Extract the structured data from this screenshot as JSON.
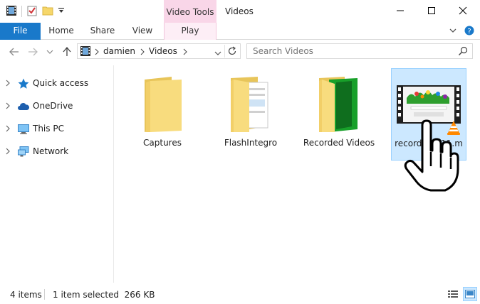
{
  "window": {
    "title": "Videos",
    "context_tab_group": "Video Tools",
    "controls": {
      "minimize": "–",
      "maximize": "☐",
      "close": "✕"
    }
  },
  "ribbon": {
    "tabs": [
      {
        "label": "File"
      },
      {
        "label": "Home"
      },
      {
        "label": "Share"
      },
      {
        "label": "View"
      },
      {
        "label": "Play"
      }
    ]
  },
  "navigation": {
    "breadcrumb": [
      "damien",
      "Videos"
    ],
    "search_placeholder": "Search Videos"
  },
  "sidebar": {
    "items": [
      {
        "label": "Quick access",
        "icon": "star-icon"
      },
      {
        "label": "OneDrive",
        "icon": "cloud-icon"
      },
      {
        "label": "This PC",
        "icon": "computer-icon"
      },
      {
        "label": "Network",
        "icon": "network-icon"
      }
    ]
  },
  "content": {
    "items": [
      {
        "label": "Captures",
        "type": "folder"
      },
      {
        "label": "FlashIntegro",
        "type": "folder"
      },
      {
        "label": "Recorded Videos",
        "type": "folder"
      },
      {
        "label": "record...0011.m",
        "type": "video",
        "selected": true
      }
    ]
  },
  "status": {
    "item_count": "4 items",
    "selection": "1 item selected  266 KB"
  },
  "colors": {
    "accent": "#1979ca",
    "selection_bg": "#cce8ff",
    "selection_border": "#99d1ff",
    "context_tab": "#f9d6e8",
    "folder": "#f6d76b"
  }
}
